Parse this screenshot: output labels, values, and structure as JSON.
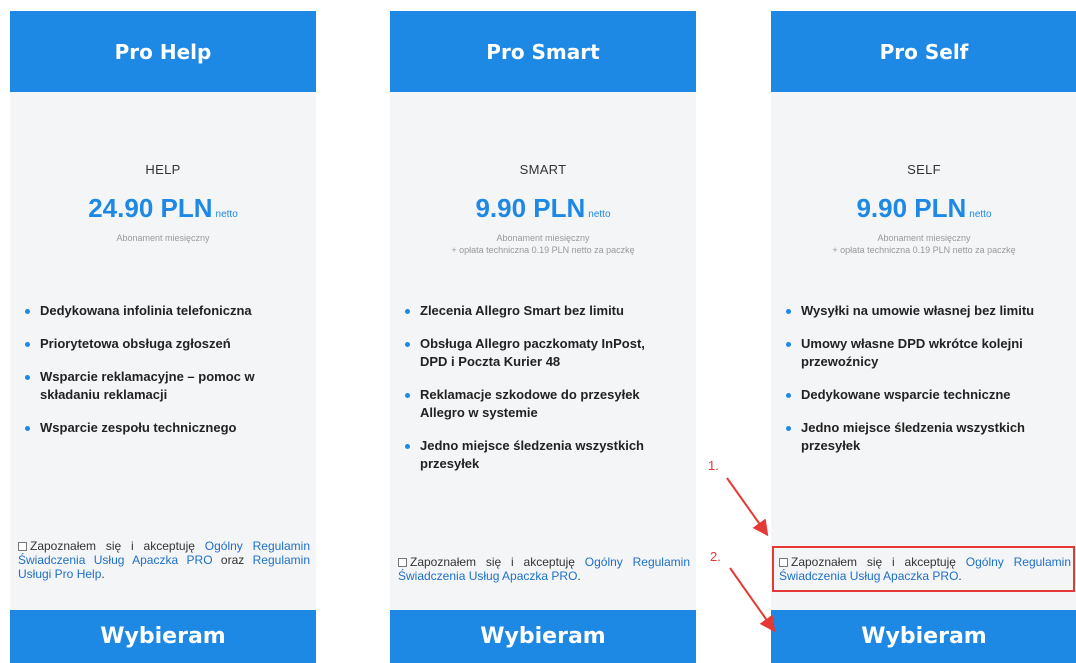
{
  "plans": [
    {
      "header": "Pro Help",
      "code": "HELP",
      "price": "24.90 PLN",
      "price_suffix": "netto",
      "note_line1": "Abonament miesięczny",
      "note_line2": "",
      "features": [
        "Dedykowana infolinia telefoniczna",
        "Priorytetowa obsługa zgłoszeń",
        "Wsparcie reklamacyjne – pomoc w składaniu reklamacji",
        "Wsparcie zespołu technicznego"
      ],
      "consent": {
        "text": "Zapoznałem się i akceptuję",
        "link1": "Ogólny Regulamin Świadczenia Usług Apaczka PRO",
        "middle": "oraz",
        "link2": "Regulamin Usługi Pro Help",
        "end": "."
      },
      "button": "Wybieram"
    },
    {
      "header": "Pro Smart",
      "code": "SMART",
      "price": "9.90 PLN",
      "price_suffix": "netto",
      "note_line1": "Abonament miesięczny",
      "note_line2": "+ opłata techniczna 0.19 PLN netto za paczkę",
      "features": [
        "Zlecenia Allegro Smart bez limitu",
        "Obsługa Allegro paczkomaty InPost, DPD i Poczta Kurier 48",
        "Reklamacje szkodowe do przesyłek Allegro w systemie",
        "Jedno miejsce śledzenia wszystkich przesyłek"
      ],
      "consent": {
        "text": "Zapoznałem się i akceptuję",
        "link1": "Ogólny Regulamin Świadczenia Usług Apaczka PRO",
        "end": "."
      },
      "button": "Wybieram"
    },
    {
      "header": "Pro Self",
      "code": "SELF",
      "price": "9.90 PLN",
      "price_suffix": "netto",
      "note_line1": "Abonament miesięczny",
      "note_line2": "+ opłata techniczna 0.19 PLN netto za paczkę",
      "features": [
        "Wysyłki na umowie własnej bez limitu",
        "Umowy własne DPD wkrótce kolejni przewoźnicy",
        "Dedykowane wsparcie techniczne",
        "Jedno miejsce śledzenia wszystkich przesyłek"
      ],
      "consent": {
        "text": "Zapoznałem się i akceptuję",
        "link1": "Ogólny Regulamin Świadczenia Usług Apaczka PRO",
        "end": "."
      },
      "button": "Wybieram"
    }
  ],
  "annotations": {
    "step1": "1.",
    "step2": "2.",
    "color": "#e53935"
  },
  "colors": {
    "accent": "#1e88e5",
    "card_bg": "#f4f5f7"
  }
}
